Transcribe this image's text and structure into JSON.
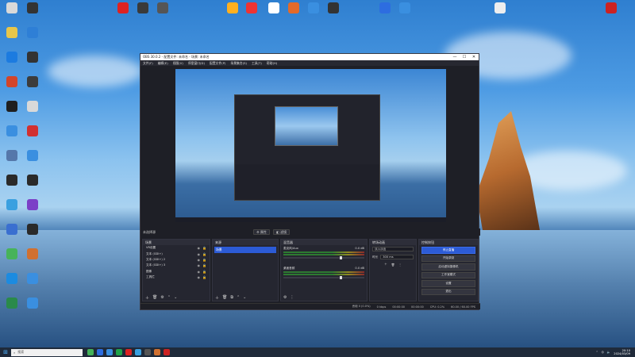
{
  "desktop": {
    "icons_left": [
      {
        "label": "",
        "color": "#d9d9d9"
      },
      {
        "label": "",
        "color": "#e8c64a"
      },
      {
        "label": "",
        "color": "#1c7be0"
      },
      {
        "label": "",
        "color": "#d2452a"
      },
      {
        "label": "",
        "color": "#1f1f1f"
      },
      {
        "label": "",
        "color": "#3a8fe0"
      },
      {
        "label": "",
        "color": "#5577aa"
      },
      {
        "label": "",
        "color": "#2a2a2a"
      },
      {
        "label": "",
        "color": "#3aa0e0"
      },
      {
        "label": "",
        "color": "#3a6fd0"
      },
      {
        "label": "",
        "color": "#47b35a"
      },
      {
        "label": "",
        "color": "#1c8be0"
      },
      {
        "label": "",
        "color": "#2a8a4a"
      },
      {
        "label": "",
        "color": "#333333"
      },
      {
        "label": "",
        "color": "#2e7fd6"
      },
      {
        "label": "",
        "color": "#333333"
      },
      {
        "label": "",
        "color": "#3c3c3c"
      },
      {
        "label": "",
        "color": "#d9d9d9"
      },
      {
        "label": "",
        "color": "#d13030"
      },
      {
        "label": "",
        "color": "#3a8fe0"
      },
      {
        "label": "",
        "color": "#2a2a2a"
      },
      {
        "label": "",
        "color": "#7b3fc7"
      },
      {
        "label": "",
        "color": "#2a2a2a"
      },
      {
        "label": "",
        "color": "#d07030"
      },
      {
        "label": "",
        "color": "#3a8fe0"
      },
      {
        "label": "",
        "color": "#3a8fe0"
      }
    ],
    "icons_top": [
      {
        "label": "",
        "color": "#d22"
      },
      {
        "label": "",
        "color": "#3a3a3a"
      },
      {
        "label": "",
        "color": "#555"
      },
      {
        "label": "",
        "color": "#ffb020"
      },
      {
        "label": "",
        "color": "#e33"
      },
      {
        "label": "",
        "color": "#fff"
      },
      {
        "label": "",
        "color": "#e36a2a"
      },
      {
        "label": "",
        "color": "#3a8fe0"
      },
      {
        "label": "",
        "color": "#333"
      },
      {
        "label": "",
        "color": "#2d6de0"
      },
      {
        "label": "",
        "color": "#3a8fe0"
      },
      {
        "label": "",
        "color": "#eee"
      },
      {
        "label": "",
        "color": "#c22"
      }
    ]
  },
  "obs": {
    "title": "OBS 30.0.2 - 配置文件: 未命名 - 场景: 未命名",
    "window_buttons": [
      "—",
      "☐",
      "✕"
    ],
    "menu": [
      "文件(F)",
      "编辑(E)",
      "视图(V)",
      "停靠窗口(D)",
      "配置文件(P)",
      "场景集合(S)",
      "工具(T)",
      "帮助(H)"
    ],
    "scene_bar": {
      "label": "未选择源",
      "props_button": "⚙ 属性",
      "filter_button": "◧ 滤镜"
    },
    "docks": {
      "scenes": {
        "title": "场景",
        "items": [
          "场景"
        ]
      },
      "sources": {
        "title": "来源",
        "items": [
          "VR设置",
          "文本 (GDI+)",
          "文本 (GDI+) 2",
          "文本 (GDI+) 3",
          "图像",
          "工具栏"
        ]
      },
      "mixer": {
        "title": "混音器",
        "channels": [
          {
            "name": "麦克风/Aux",
            "db": "0.0 dB",
            "fader": 0.9
          },
          {
            "name": "桌面音频",
            "db": "0.0 dB",
            "fader": 0.9
          }
        ]
      },
      "transitions": {
        "title": "转场动画",
        "type": "淡入淡出",
        "duration_label": "时长",
        "duration": "300 ms"
      },
      "controls": {
        "title": "控制按钮",
        "buttons": [
          "停止直播",
          "开始录制",
          "启动虚拟摄像机",
          "工作室模式",
          "设置",
          "退出"
        ]
      }
    },
    "status": {
      "dropped": "丢帧 0 (0.0%)",
      "bitrate": "0 kbps",
      "live": "00:00:00",
      "rec": "00:00:00",
      "cpu": "CPU: 0.2%",
      "fps": "60.00 / 60.00 FPS"
    }
  },
  "taskbar": {
    "search_placeholder": "搜索",
    "time": "20:10",
    "date": "2024/03/09",
    "apps": [
      "#45b35a",
      "#2d6de0",
      "#3a8fe0",
      "#1fa34a",
      "#d22",
      "#3aa0e0",
      "#555",
      "#d07030",
      "#c22"
    ]
  }
}
